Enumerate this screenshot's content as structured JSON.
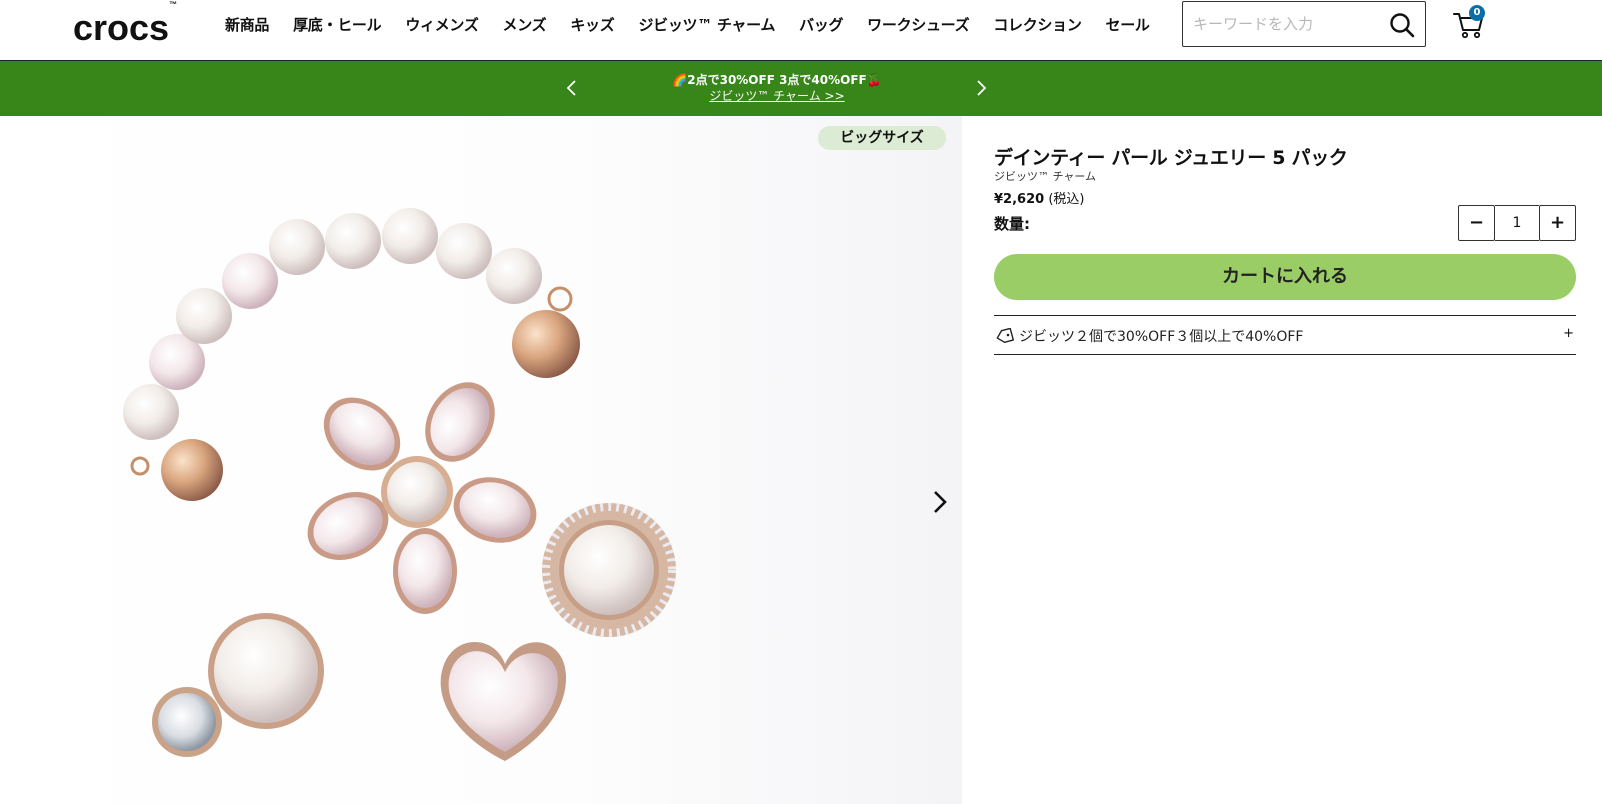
{
  "header": {
    "logo": "crocs",
    "logo_tm": "™",
    "nav": [
      "新商品",
      "厚底・ヒール",
      "ウィメンズ",
      "メンズ",
      "キッズ",
      "ジビッツ™ チャーム",
      "バッグ",
      "ワークシューズ",
      "コレクション",
      "セール"
    ],
    "search_placeholder": "キーワードを入力",
    "search_value": "",
    "cart_count": "0",
    "icons": {
      "search": "search-icon",
      "cart": "cart-icon"
    }
  },
  "promo": {
    "line1": "🌈2点で30%OFF 3点で40%OFF🍒",
    "line2": "ジビッツ™ チャーム >>",
    "bg_color": "#38861a",
    "icons": {
      "prev": "chevron-left-icon",
      "next": "chevron-right-icon"
    }
  },
  "gallery": {
    "badge": "ビッグサイズ",
    "next_icon": "chevron-right-icon"
  },
  "product": {
    "title": "デインティー パール ジュエリー 5 パック",
    "subtitle": "ジビッツ™ チャーム",
    "price": "¥2,620",
    "price_note": "(税込)",
    "qty_label": "数量:",
    "qty_minus": "−",
    "qty_value": "1",
    "qty_plus": "+",
    "add_to_cart": "カートに入れる",
    "add_to_cart_color": "#9acd66",
    "promo_text": "ジビッツ２個で30%OFF３個以上で40%OFF",
    "promo_expand": "+",
    "promo_icon": "tag-icon"
  }
}
